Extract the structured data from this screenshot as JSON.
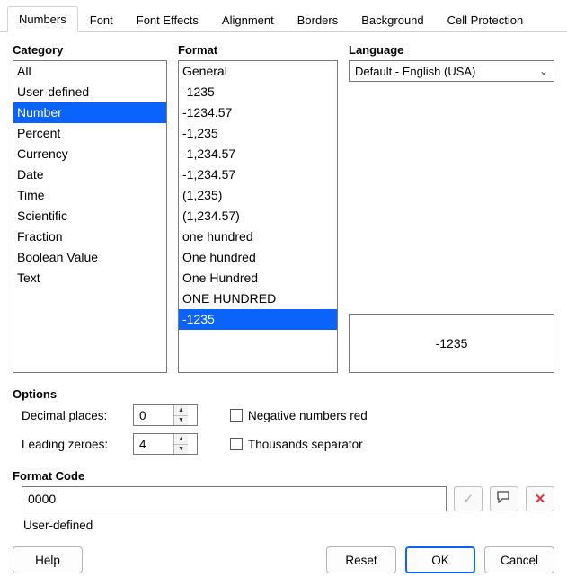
{
  "tabs": {
    "items": [
      {
        "label": "Numbers",
        "active": true
      },
      {
        "label": "Font"
      },
      {
        "label": "Font Effects"
      },
      {
        "label": "Alignment"
      },
      {
        "label": "Borders"
      },
      {
        "label": "Background"
      },
      {
        "label": "Cell Protection"
      }
    ]
  },
  "sections": {
    "category_title": "Category",
    "format_title": "Format",
    "language_title": "Language",
    "options_title": "Options",
    "format_code_title": "Format Code"
  },
  "category": {
    "items": [
      "All",
      "User-defined",
      "Number",
      "Percent",
      "Currency",
      "Date",
      "Time",
      "Scientific",
      "Fraction",
      "Boolean Value",
      "Text"
    ],
    "selected_index": 2
  },
  "format": {
    "items": [
      "General",
      "-1235",
      "-1234.57",
      "-1,235",
      "-1,234.57",
      "-1,234.57",
      "(1,235)",
      "(1,234.57)",
      "one hundred",
      "One hundred",
      "One Hundred",
      "ONE HUNDRED",
      "-1235"
    ],
    "selected_index": 12
  },
  "language": {
    "value": "Default - English (USA)"
  },
  "preview": {
    "value": "-1235"
  },
  "options": {
    "decimal_places_label": "Decimal places:",
    "decimal_places_value": "0",
    "leading_zeroes_label": "Leading zeroes:",
    "leading_zeroes_value": "4",
    "negative_red_label": "Negative numbers red",
    "negative_red_checked": false,
    "thousands_sep_label": "Thousands separator",
    "thousands_sep_checked": false
  },
  "format_code": {
    "value": "0000",
    "status": "User-defined"
  },
  "icons": {
    "accept": "✓",
    "comment": "✎",
    "delete": "✕",
    "chevron_down": "⌄",
    "tri_up": "▲",
    "tri_down": "▼"
  },
  "buttons": {
    "help": "Help",
    "reset": "Reset",
    "ok": "OK",
    "cancel": "Cancel"
  }
}
